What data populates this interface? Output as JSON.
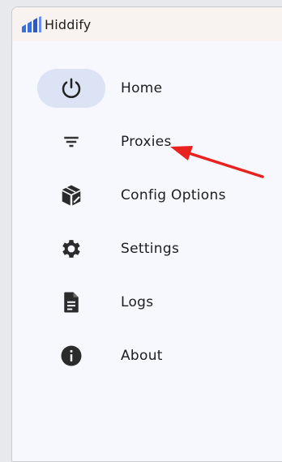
{
  "app": {
    "title": "Hiddify",
    "logo_icon": "bars-logo-icon",
    "brand_color": "#2d6cdf"
  },
  "nav": {
    "items": [
      {
        "label": "Home",
        "icon": "power-icon",
        "selected": true
      },
      {
        "label": "Proxies",
        "icon": "filter-lines-icon",
        "selected": false
      },
      {
        "label": "Config Options",
        "icon": "package-icon",
        "selected": false
      },
      {
        "label": "Settings",
        "icon": "gear-icon",
        "selected": false
      },
      {
        "label": "Logs",
        "icon": "document-icon",
        "selected": false
      },
      {
        "label": "About",
        "icon": "info-icon",
        "selected": false
      }
    ]
  },
  "colors": {
    "selected_pill": "#dbe3f5",
    "annotation_arrow": "#e8221e"
  }
}
